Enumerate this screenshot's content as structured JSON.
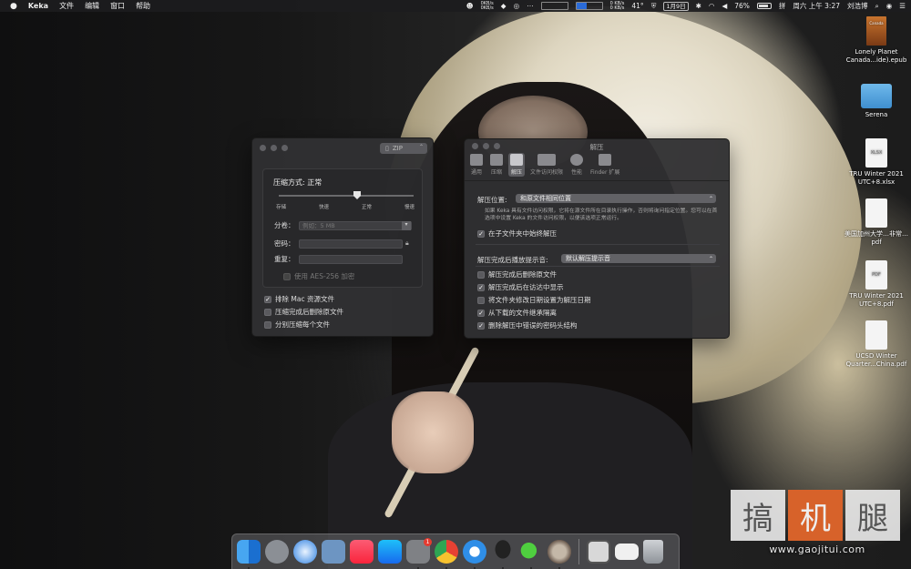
{
  "menubar": {
    "apple": "",
    "app_name": "Keka",
    "menus": [
      "文件",
      "编辑",
      "窗口",
      "帮助"
    ],
    "net_up": "0KB/s",
    "net_down": "0KB/s",
    "net2_up": "0 KB/s",
    "net2_down": "0 KB/s",
    "temperature": "41°",
    "date_box": "1月9日",
    "battery": "76%",
    "clock": "周六 上午 3:27",
    "user": "刘浩博"
  },
  "desktop_icons": [
    {
      "label": "Lonely Planet Canada...ide).epub",
      "type": "book",
      "cover_text": "Canada"
    },
    {
      "label": "Serena",
      "type": "folder"
    },
    {
      "label": "TRU Winter 2021 UTC+8.xlsx",
      "type": "doc",
      "tag": "XLSX"
    },
    {
      "label": "美国加州大学…非常…pdf",
      "type": "doc",
      "tag": ""
    },
    {
      "label": "TRU Winter 2021 UTC+8.pdf",
      "type": "doc",
      "tag": "PDF"
    },
    {
      "label": "UCSD Winter Quarter...China.pdf",
      "type": "doc",
      "tag": ""
    }
  ],
  "compress_window": {
    "format": "ZIP",
    "method_label": "压缩方式: 正常",
    "levels": [
      "存储",
      "快速",
      "正常",
      "慢速"
    ],
    "split_label": "分卷：",
    "split_placeholder": "例如：5 MB",
    "password_label": "密码：",
    "repeat_label": "重复：",
    "aes_label": "使用 AES-256 加密",
    "options": [
      {
        "label": "排除 Mac 资源文件",
        "checked": true
      },
      {
        "label": "压缩完成后删除原文件",
        "checked": false
      },
      {
        "label": "分别压缩每个文件",
        "checked": false
      }
    ]
  },
  "prefs_window": {
    "title": "解压",
    "tabs": [
      "通用",
      "压缩",
      "解压",
      "文件访问权限",
      "性能",
      "Finder 扩展"
    ],
    "location_label": "解压位置:",
    "location_value": "和原文件相同位置",
    "note": "如果 Keka 具有文件访问权限，它将在源文件所在目录执行操作，否则将询问指定位置。您可以在首选项中设置 Keka 的文件访问权限，以便该选项正常运行。",
    "subfolder_option": {
      "label": "在子文件夹中始终解压",
      "checked": true
    },
    "sound_label": "解压完成后播放提示音:",
    "sound_value": "默认解压提示音",
    "options": [
      {
        "label": "解压完成后删除原文件",
        "checked": false
      },
      {
        "label": "解压完成后在访达中显示",
        "checked": true
      },
      {
        "label": "将文件夹修改日期设置为解压日期",
        "checked": false
      },
      {
        "label": "从下载的文件继承隔离",
        "checked": true
      },
      {
        "label": "删除解压中错误的密码头结构",
        "checked": true
      }
    ]
  },
  "dock": {
    "apps": [
      "finder",
      "launchpad",
      "safari",
      "preview",
      "music",
      "app-store",
      "system-preferences",
      "chrome",
      "baidu-netdisk",
      "qq",
      "wechat",
      "keka"
    ],
    "badge": "1",
    "right_items": [
      "stack",
      "document",
      "trash"
    ]
  },
  "watermark": {
    "chars": [
      "搞",
      "机",
      "腿"
    ],
    "url": "www.gaojitui.com"
  }
}
